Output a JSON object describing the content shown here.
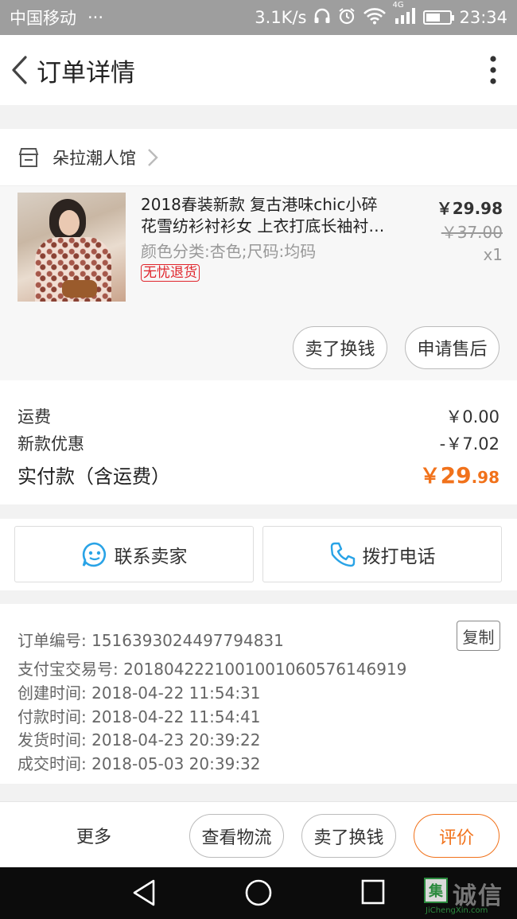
{
  "status_bar": {
    "carrier": "中国移动",
    "dots": "···",
    "speed": "3.1K/s",
    "network": "4G",
    "time": "23:34",
    "battery_level": 0.6
  },
  "header": {
    "title": "订单详情"
  },
  "shop": {
    "name": "朵拉潮人馆"
  },
  "item": {
    "title_line1": "2018春装新款 复古港味chic小碎",
    "title_line2": "花雪纺衫衬衫女 上衣打底长袖衬…",
    "spec": "颜色分类:杏色;尺码:均码",
    "tag": "无忧退货",
    "price": "￥29.98",
    "original_price": "￥37.00",
    "quantity": "x1",
    "actions": [
      "卖了换钱",
      "申请售后"
    ]
  },
  "fees": {
    "shipping_label": "运费",
    "shipping_value": "￥0.00",
    "discount_label": "新款优惠",
    "discount_value": "-￥7.02",
    "total_label": "实付款（含运费）",
    "total_currency": "￥",
    "total_integer": "29",
    "total_decimal": ".98"
  },
  "contact": {
    "seller_label": "联系卖家",
    "phone_label": "拨打电话"
  },
  "order_info": {
    "order_no": "订单编号: 1516393024497794831",
    "alipay_no": "支付宝交易号: 2018042221001001060576146919",
    "created": "创建时间: 2018-04-22 11:54:31",
    "paid": "付款时间: 2018-04-22 11:54:41",
    "shipped": "发货时间: 2018-04-23 20:39:22",
    "completed": "成交时间: 2018-05-03 20:39:32",
    "copy_label": "复制"
  },
  "bottom_bar": {
    "more": "更多",
    "logistics": "查看物流",
    "resell": "卖了换钱",
    "review": "评价"
  },
  "watermark": {
    "logo_char": "集",
    "text": "诚信",
    "sub": "JiChengXin.com"
  },
  "colors": {
    "accent": "#f1721b",
    "tag_red": "#e0262d",
    "contact_blue": "#29a3e6"
  }
}
